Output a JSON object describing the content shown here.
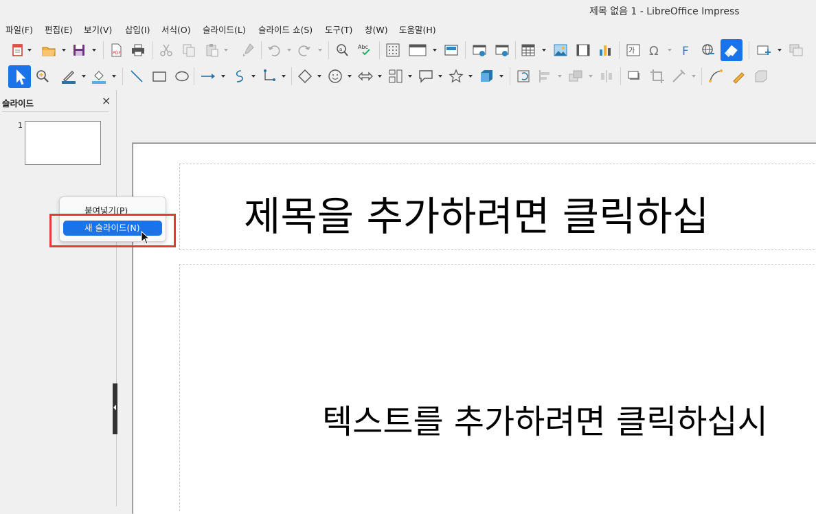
{
  "window": {
    "title": "제목 없음 1 - LibreOffice Impress"
  },
  "menubar": [
    {
      "label": "파일(F)"
    },
    {
      "label": "편집(E)"
    },
    {
      "label": "보기(V)"
    },
    {
      "label": "삽입(I)"
    },
    {
      "label": "서식(O)"
    },
    {
      "label": "슬라이드(L)"
    },
    {
      "label": "슬라이드 쇼(S)"
    },
    {
      "label": "도구(T)"
    },
    {
      "label": "창(W)"
    },
    {
      "label": "도움말(H)"
    }
  ],
  "toolbar1": [
    "new-icon",
    "open-icon",
    "save-icon",
    "export-pdf-icon",
    "print-icon",
    "cut-icon",
    "copy-icon",
    "paste-icon",
    "clone-formatting-icon",
    "undo-icon",
    "redo-icon",
    "find-replace-icon",
    "spelling-icon",
    "grid-icon",
    "display-views-icon",
    "master-slide-icon",
    "start-first-slide-icon",
    "start-current-slide-icon",
    "table-icon",
    "image-icon",
    "media-icon",
    "chart-icon",
    "textbox-icon",
    "special-character-icon",
    "fontwork-icon",
    "hyperlink-icon",
    "interaction-icon",
    "new-slide-icon",
    "duplicate-slide-icon"
  ],
  "toolbar2": [
    "select-icon",
    "zoom-icon",
    "line-color-icon",
    "fill-color-icon",
    "line-icon",
    "rectangle-icon",
    "ellipse-icon",
    "line-arrow-icon",
    "curve-icon",
    "connector-icon",
    "basic-shapes-icon",
    "symbol-shapes-icon",
    "block-arrows-icon",
    "flowchart-icon",
    "callouts-icon",
    "stars-icon",
    "3d-objects-icon",
    "rotate-icon",
    "align-icon",
    "arrange-icon",
    "distribute-icon",
    "shadow-icon",
    "crop-icon",
    "filter-icon",
    "points-icon",
    "glue-points-icon",
    "toggle-extrusion-icon"
  ],
  "sidebar": {
    "title": "슬라이드",
    "close_glyph": "×",
    "slides": [
      {
        "number": "1"
      }
    ]
  },
  "slide": {
    "title_placeholder": "제목을 추가하려면 클릭하십",
    "body_placeholder": "텍스트를 추가하려면 클릭하십시"
  },
  "context_menu": {
    "items": [
      {
        "label": "붙여넣기(P)",
        "selected": false
      },
      {
        "label": "새 슬라이드(N)",
        "selected": true
      }
    ]
  },
  "colors": {
    "accent": "#1a73e8",
    "highlight_border": "#e53935"
  }
}
